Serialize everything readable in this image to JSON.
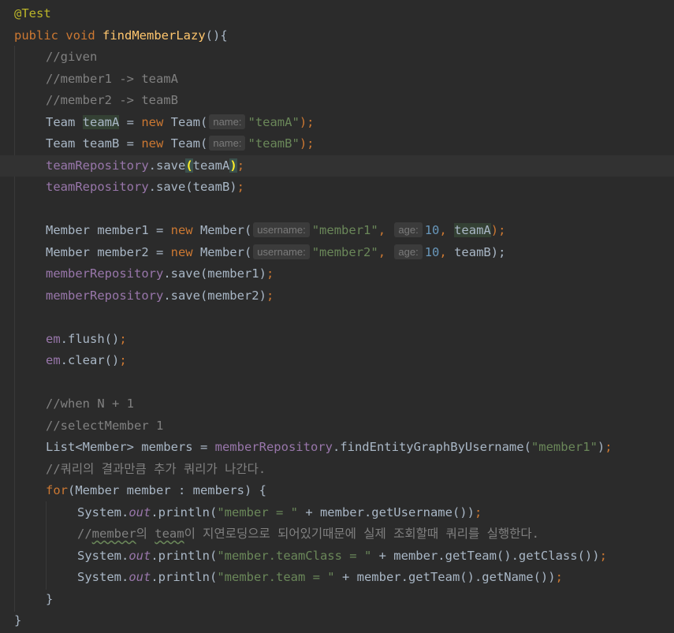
{
  "editor": {
    "theme_colors": {
      "background": "#2b2b2b",
      "keyword": "#cc7832",
      "method": "#ffc66d",
      "annotation": "#bbb529",
      "comment": "#808080",
      "string": "#6a8759",
      "number": "#6897bb",
      "field": "#9876aa",
      "text": "#a9b7c6"
    },
    "annotation": "@Test",
    "sig": {
      "kw_public": "public",
      "kw_void": "void",
      "method": "findMemberLazy",
      "rest": "(){"
    },
    "c_given": "//given",
    "c_m1": "//member1 -> teamA",
    "c_m2": "//member2 -> teamB",
    "teamA": {
      "type": "Team",
      "var": "teamA",
      "eq": " = ",
      "kw": "new",
      "ctor": " Team(",
      "hint": "name:",
      "arg": "\"teamA\"",
      "end": ");"
    },
    "teamB": {
      "type": "Team",
      "var": "teamB",
      "eq": " = ",
      "kw": "new",
      "ctor": " Team(",
      "hint": "name:",
      "arg": "\"teamB\"",
      "end": ");"
    },
    "saveA": {
      "repo": "teamRepository",
      "call": ".save",
      "open": "(",
      "arg": "teamA",
      "close": ")",
      "semi": ";"
    },
    "saveB": {
      "repo": "teamRepository",
      "call": ".save(teamB)",
      "semi": ";"
    },
    "member1": {
      "decl": "Member member1 = ",
      "kw": "new",
      "ctor": " Member(",
      "hint_user": "username:",
      "arg1": "\"member1\"",
      "comma1": ",",
      "hint_age": "age:",
      "arg2": "10",
      "comma2": ",",
      "arg3": "teamA",
      "end": ");"
    },
    "member2": {
      "decl": "Member member2 = ",
      "kw": "new",
      "ctor": " Member(",
      "hint_user": "username:",
      "arg1": "\"member2\"",
      "comma1": ",",
      "hint_age": "age:",
      "arg2": "10",
      "comma2": ",",
      "arg3": "teamB);",
      "end": ""
    },
    "saveM1": {
      "repo": "memberRepository",
      "call": ".save(member1)",
      "semi": ";"
    },
    "saveM2": {
      "repo": "memberRepository",
      "call": ".save(member2)",
      "semi": ";"
    },
    "flush": {
      "obj": "em",
      "call": ".flush()",
      "semi": ";"
    },
    "clear": {
      "obj": "em",
      "call": ".clear()",
      "semi": ";"
    },
    "c_when": "//when N + 1",
    "c_select": "//selectMember 1",
    "listLine": {
      "decl": "List<Member> members = ",
      "repo": "memberRepository",
      "call": ".findEntityGraphByUsername(",
      "arg": "\"member1\"",
      "close": ")",
      "semi": ";"
    },
    "c_extra": "//쿼리의 결과만큼 추가 쿼리가 나간다.",
    "forLine": {
      "kw": "for",
      "rest": "(Member member : members) {"
    },
    "p1": {
      "pre": "System.",
      "out": "out",
      "mid": ".println(",
      "str": "\"member = \"",
      "post": " + member.getUsername())",
      "semi": ";"
    },
    "c_lazy": {
      "a": "//",
      "b": "member",
      "c": "의 ",
      "d": "team",
      "e": "이 지연로딩으로 되어있기때문에 실제 조회할때 쿼리를 실행한다."
    },
    "p2": {
      "pre": "System.",
      "out": "out",
      "mid": ".println(",
      "str": "\"member.teamClass = \"",
      "post": " + member.getTeam().getClass())",
      "semi": ";"
    },
    "p3": {
      "pre": "System.",
      "out": "out",
      "mid": ".println(",
      "str": "\"member.team = \"",
      "post": " + member.getTeam().getName())",
      "semi": ";"
    },
    "inner_close": "}",
    "outer_close": "}"
  }
}
